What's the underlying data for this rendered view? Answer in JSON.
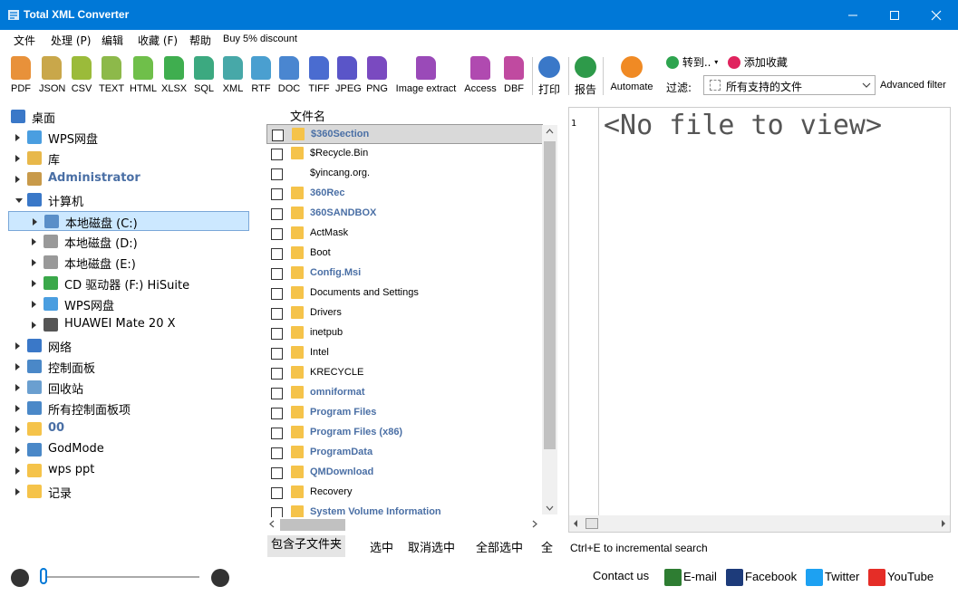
{
  "window": {
    "title": "Total XML Converter"
  },
  "menu": [
    "文件",
    "处理 (P)",
    "编辑",
    "收藏 (F)",
    "帮助",
    "Buy 5% discount"
  ],
  "toolbar": {
    "formats": [
      {
        "label": "PDF",
        "color": "#e8913a"
      },
      {
        "label": "JSON",
        "color": "#c9a74a"
      },
      {
        "label": "CSV",
        "color": "#9bbb3a"
      },
      {
        "label": "TEXT",
        "color": "#8db94a"
      },
      {
        "label": "HTML",
        "color": "#6fbf4a"
      },
      {
        "label": "XLSX",
        "color": "#3fae4f"
      },
      {
        "label": "SQL",
        "color": "#3ca980"
      },
      {
        "label": "XML",
        "color": "#47a8a8"
      },
      {
        "label": "RTF",
        "color": "#4a9fd0"
      },
      {
        "label": "DOC",
        "color": "#4a86d0"
      },
      {
        "label": "TIFF",
        "color": "#4a6cd0"
      },
      {
        "label": "JPEG",
        "color": "#5a55c8"
      },
      {
        "label": "PNG",
        "color": "#7a4ac0"
      },
      {
        "label": "Image extract",
        "color": "#9a4ab8"
      },
      {
        "label": "Access",
        "color": "#b04ab0"
      },
      {
        "label": "DBF",
        "color": "#c04aa0"
      }
    ],
    "print_label": "打印",
    "report_label": "报告",
    "automate_label": "Automate",
    "goto_label": "转到..",
    "favorite_label": "添加收藏",
    "filter_label": "过滤:",
    "filter_value": "所有支持的文件",
    "advanced_filter": "Advanced filter"
  },
  "tree": {
    "items": [
      {
        "label": "桌面",
        "style": "normal"
      },
      {
        "label": "WPS网盘",
        "style": "normal"
      },
      {
        "label": "库",
        "style": "normal"
      },
      {
        "label": "Administrator",
        "style": "bold"
      },
      {
        "label": "计算机",
        "style": "normal"
      },
      {
        "label": "本地磁盘 (C:)",
        "style": "normal"
      },
      {
        "label": "本地磁盘 (D:)",
        "style": "normal"
      },
      {
        "label": "本地磁盘 (E:)",
        "style": "normal"
      },
      {
        "label": "CD 驱动器 (F:) HiSuite",
        "style": "normal"
      },
      {
        "label": "WPS网盘",
        "style": "normal"
      },
      {
        "label": "HUAWEI Mate 20 X",
        "style": "normal"
      },
      {
        "label": "网络",
        "style": "normal"
      },
      {
        "label": "控制面板",
        "style": "normal"
      },
      {
        "label": "回收站",
        "style": "normal"
      },
      {
        "label": "所有控制面板项",
        "style": "normal"
      },
      {
        "label": "00",
        "style": "bold"
      },
      {
        "label": "GodMode",
        "style": "normal"
      },
      {
        "label": "wps ppt",
        "style": "normal"
      },
      {
        "label": "记录",
        "style": "normal"
      }
    ]
  },
  "files": {
    "header": "文件名",
    "rows": [
      {
        "name": "$360Section",
        "bold": true,
        "folder": true
      },
      {
        "name": "$Recycle.Bin",
        "bold": false,
        "folder": true
      },
      {
        "name": "$yincang.org.",
        "bold": false,
        "folder": false
      },
      {
        "name": "360Rec",
        "bold": true,
        "folder": true
      },
      {
        "name": "360SANDBOX",
        "bold": true,
        "folder": true
      },
      {
        "name": "ActMask",
        "bold": false,
        "folder": true
      },
      {
        "name": "Boot",
        "bold": false,
        "folder": true
      },
      {
        "name": "Config.Msi",
        "bold": true,
        "folder": true
      },
      {
        "name": "Documents and Settings",
        "bold": false,
        "folder": true
      },
      {
        "name": "Drivers",
        "bold": false,
        "folder": true
      },
      {
        "name": "inetpub",
        "bold": false,
        "folder": true
      },
      {
        "name": "Intel",
        "bold": false,
        "folder": true
      },
      {
        "name": "KRECYCLE",
        "bold": false,
        "folder": true
      },
      {
        "name": "omniformat",
        "bold": true,
        "folder": true
      },
      {
        "name": "Program Files",
        "bold": true,
        "folder": true
      },
      {
        "name": "Program Files (x86)",
        "bold": true,
        "folder": true
      },
      {
        "name": "ProgramData",
        "bold": true,
        "folder": true
      },
      {
        "name": "QMDownload",
        "bold": true,
        "folder": true
      },
      {
        "name": "Recovery",
        "bold": false,
        "folder": true
      },
      {
        "name": "System Volume Information",
        "bold": true,
        "folder": true
      }
    ],
    "actions": [
      "包含子文件夹",
      "选中",
      "取消选中",
      "全部选中",
      "全"
    ]
  },
  "viewer": {
    "line_number": "1",
    "placeholder": "<No file to view>",
    "hint": "Ctrl+E to incremental search"
  },
  "footer": {
    "contact": "Contact us",
    "email": "E-mail",
    "facebook": "Facebook",
    "twitter": "Twitter",
    "youtube": "YouTube"
  },
  "colors": {
    "titlebar": "#0078d7",
    "folder": "#f5c34a",
    "bold_item": "#4a6fa5",
    "selection": "#cce8ff"
  }
}
